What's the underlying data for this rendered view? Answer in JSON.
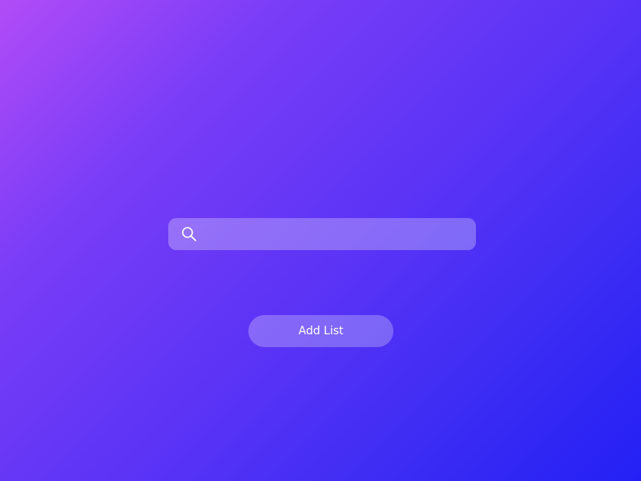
{
  "search": {
    "value": "",
    "placeholder": "",
    "icon": "search-icon"
  },
  "add_button": {
    "label": "Add List"
  },
  "colors": {
    "gradient_start": "#b14cf7",
    "gradient_end": "#2420f5",
    "text": "#ffffff"
  }
}
